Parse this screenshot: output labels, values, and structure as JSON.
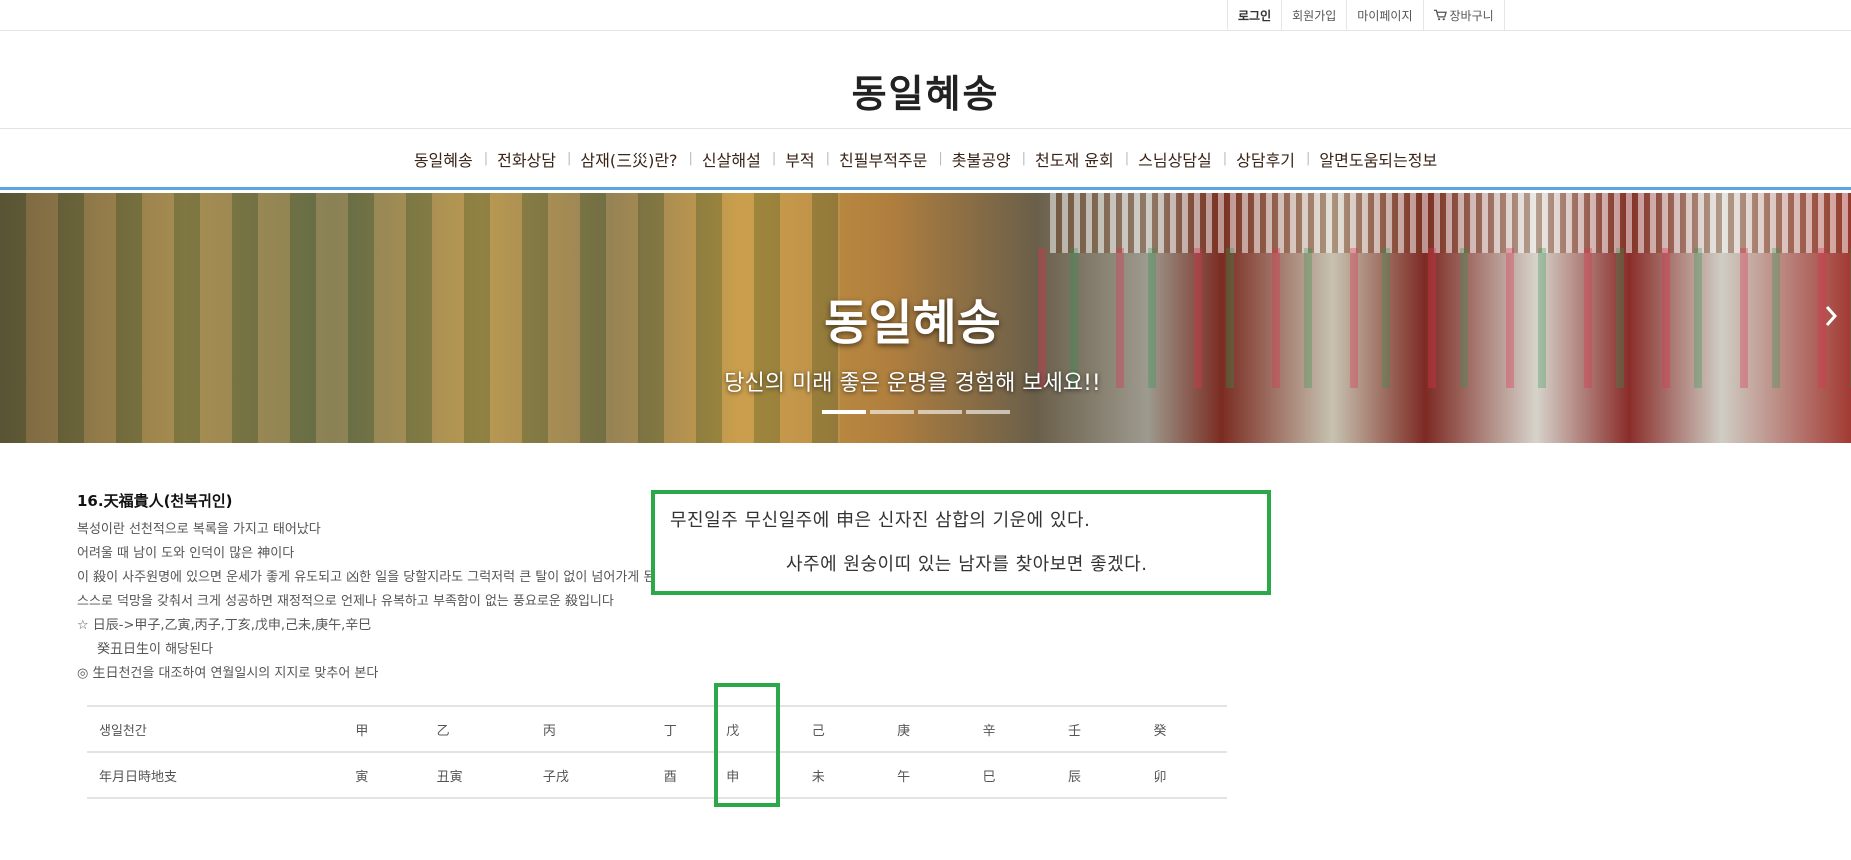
{
  "topbar": {
    "login": "로그인",
    "signup": "회원가입",
    "mypage": "마이페이지",
    "cart": "장바구니"
  },
  "logo": "동일혜송",
  "nav": {
    "items": [
      "동일혜송",
      "전화상담",
      "삼재(三災)란?",
      "신살해설",
      "부적",
      "친필부적주문",
      "촛불공양",
      "천도재 윤회",
      "스님상담실",
      "상담후기",
      "알면도움되는정보"
    ]
  },
  "hero": {
    "title": "동일혜송",
    "subtitle": "당신의 미래 좋은 운명을 경험해 보세요!!",
    "slide_count": 4,
    "active_slide": 1
  },
  "content": {
    "heading": "16.天福貴人(천복귀인)",
    "lines": [
      "복성이란 선천적으로 복록을 가지고 태어났다",
      "어려울 때 남이 도와 인덕이 많은 神이다",
      "이 殺이 사주원명에 있으면 운세가 좋게 유도되고 凶한 일을 당할지라도 그럭저럭 큰 탈이 없이 넘어가게 된다",
      "스스로 덕망을 갖춰서 크게 성공하면 재정적으로 언제나 유복하고 부족함이 없는 풍요로운 殺입니다",
      "☆ 日辰->甲子,乙寅,丙子,丁亥,戊申,己未,庚午,辛巳",
      "癸丑日生이 해당된다",
      "◎ 生日천건을 대조하여 연월일시의 지지로 맞추어 본다"
    ]
  },
  "note": {
    "line1": "무진일주 무신일주에 申은 신자진 삼합의 기운에 있다.",
    "line2": "사주에 원숭이띠 있는 남자를 찾아보면 좋겠다."
  },
  "table": {
    "rows": [
      {
        "label": "생일천간",
        "cells": [
          "甲",
          "乙",
          "丙",
          "丁",
          "戊",
          "己",
          "庚",
          "辛",
          "壬",
          "癸"
        ]
      },
      {
        "label": "年月日時地支",
        "cells": [
          "寅",
          "丑寅",
          "子戌",
          "酉",
          "申",
          "未",
          "午",
          "巳",
          "辰",
          "卯"
        ]
      }
    ]
  },
  "colors": {
    "accent_green": "#2aa84a",
    "nav_underline": "#5ba5e6"
  }
}
